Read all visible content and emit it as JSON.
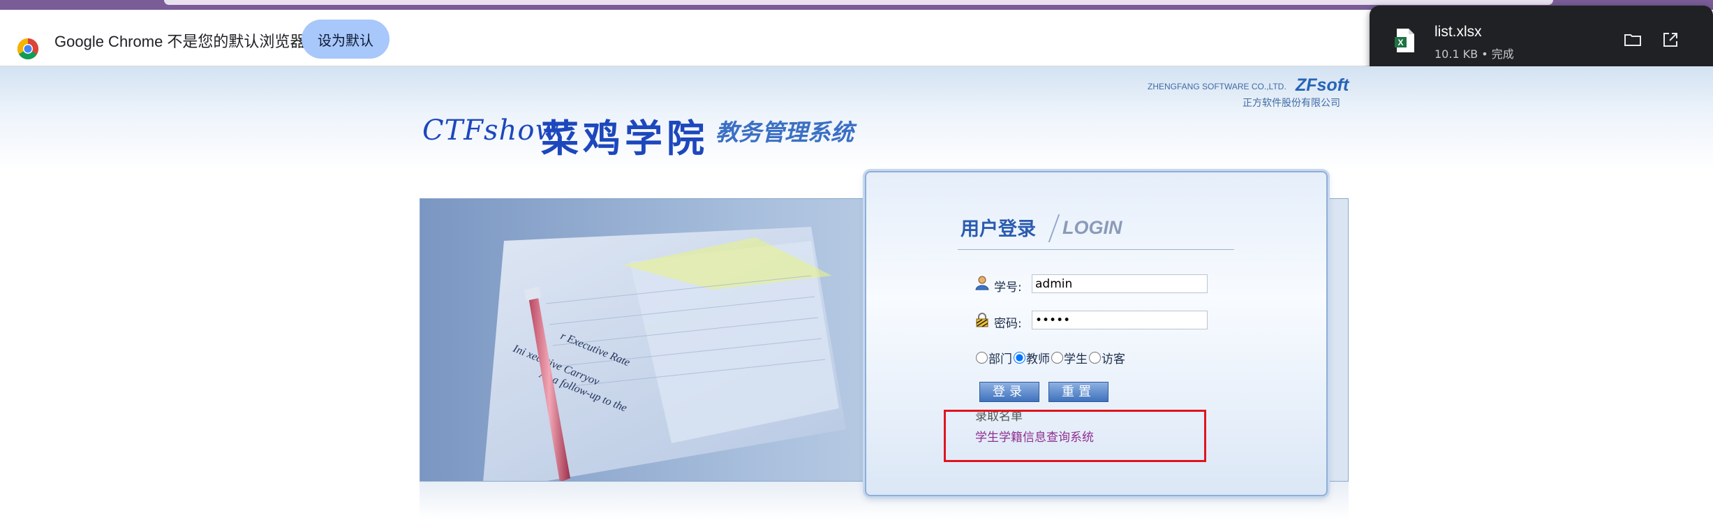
{
  "infobar": {
    "message": "Google Chrome 不是您的默认浏览器",
    "set_default_label": "设为默认"
  },
  "download": {
    "file_name": "list.xlsx",
    "status": "10.1 KB • 完成",
    "icons": [
      "xlsx-file-icon",
      "folder-icon",
      "open-external-icon"
    ]
  },
  "header": {
    "vendor_en": "ZHENGFANG SOFTWARE CO.,LTD.",
    "vendor_brand": "ZFsoft",
    "vendor_cn": "正方软件股份有限公司",
    "site_prefix": "CTFshow",
    "site_school": "菜鸡学院",
    "site_system": "教务管理系统"
  },
  "login": {
    "title_cn": "用户登录",
    "title_en": "LOGIN",
    "username_label": "学号:",
    "username_value": "admin",
    "password_label": "密码:",
    "password_value": "•••••",
    "roles": [
      {
        "label": "部门",
        "checked": false
      },
      {
        "label": "教师",
        "checked": true
      },
      {
        "label": "学生",
        "checked": false
      },
      {
        "label": "访客",
        "checked": false
      }
    ],
    "login_button": "登录",
    "reset_button": "重置",
    "admit_list_link": "录取名单",
    "student_system_link": "学生学籍信息查询系统"
  },
  "photo_text": {
    "line1": "r Executive Rate",
    "line2": "Ini  xecutive Carryov",
    "line3": "  As a follow-up to the"
  },
  "colors": {
    "annotation_border": "#e0141e",
    "link": "#8f2f8f",
    "brand_blue": "#1d47bd"
  }
}
